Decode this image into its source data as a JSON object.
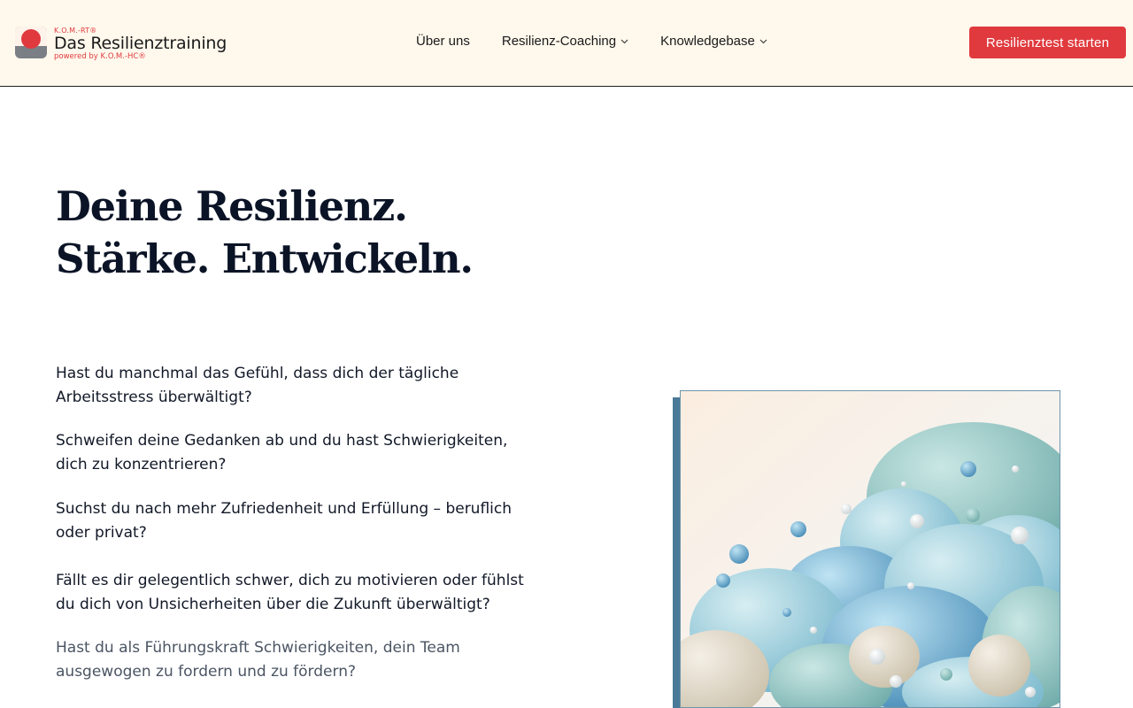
{
  "logo": {
    "small_label": "K.O.M.-RT®",
    "title": "Das Resilienztraining",
    "subtitle": "powered by K.O.M.-HC®"
  },
  "nav": {
    "items": [
      {
        "label": "Über uns",
        "dropdown": false
      },
      {
        "label": "Resilienz-Coaching",
        "dropdown": true
      },
      {
        "label": "Knowledgebase",
        "dropdown": true
      }
    ],
    "cta_label": "Resilienztest starten"
  },
  "hero": {
    "title": "Deine Resilienz.",
    "subtitle": "Stärke. Entwickeln.",
    "questions": [
      "Hast du manchmal das Gefühl, dass dich der tägliche Arbeitsstress überwältigt?",
      "Schweifen deine Gedanken ab und du hast Schwierigkeiten, dich zu konzentrieren?",
      "Suchst du nach mehr Zufriedenheit und Erfüllung – beruflich oder privat?",
      "Fällt es dir gelegentlich schwer, dich zu motivieren oder fühlst du dich von Unsicherheiten über die Zukunft überwältigt?",
      "Hast du als Führungskraft Schwierigkeiten, dein Team ausgewogen zu fordern und zu fördern?"
    ]
  },
  "colors": {
    "accent": "#e03a3e",
    "header_bg": "#fff8ec",
    "heading": "#0b1426"
  },
  "icons": {
    "chevron": "chevron-down-icon"
  }
}
